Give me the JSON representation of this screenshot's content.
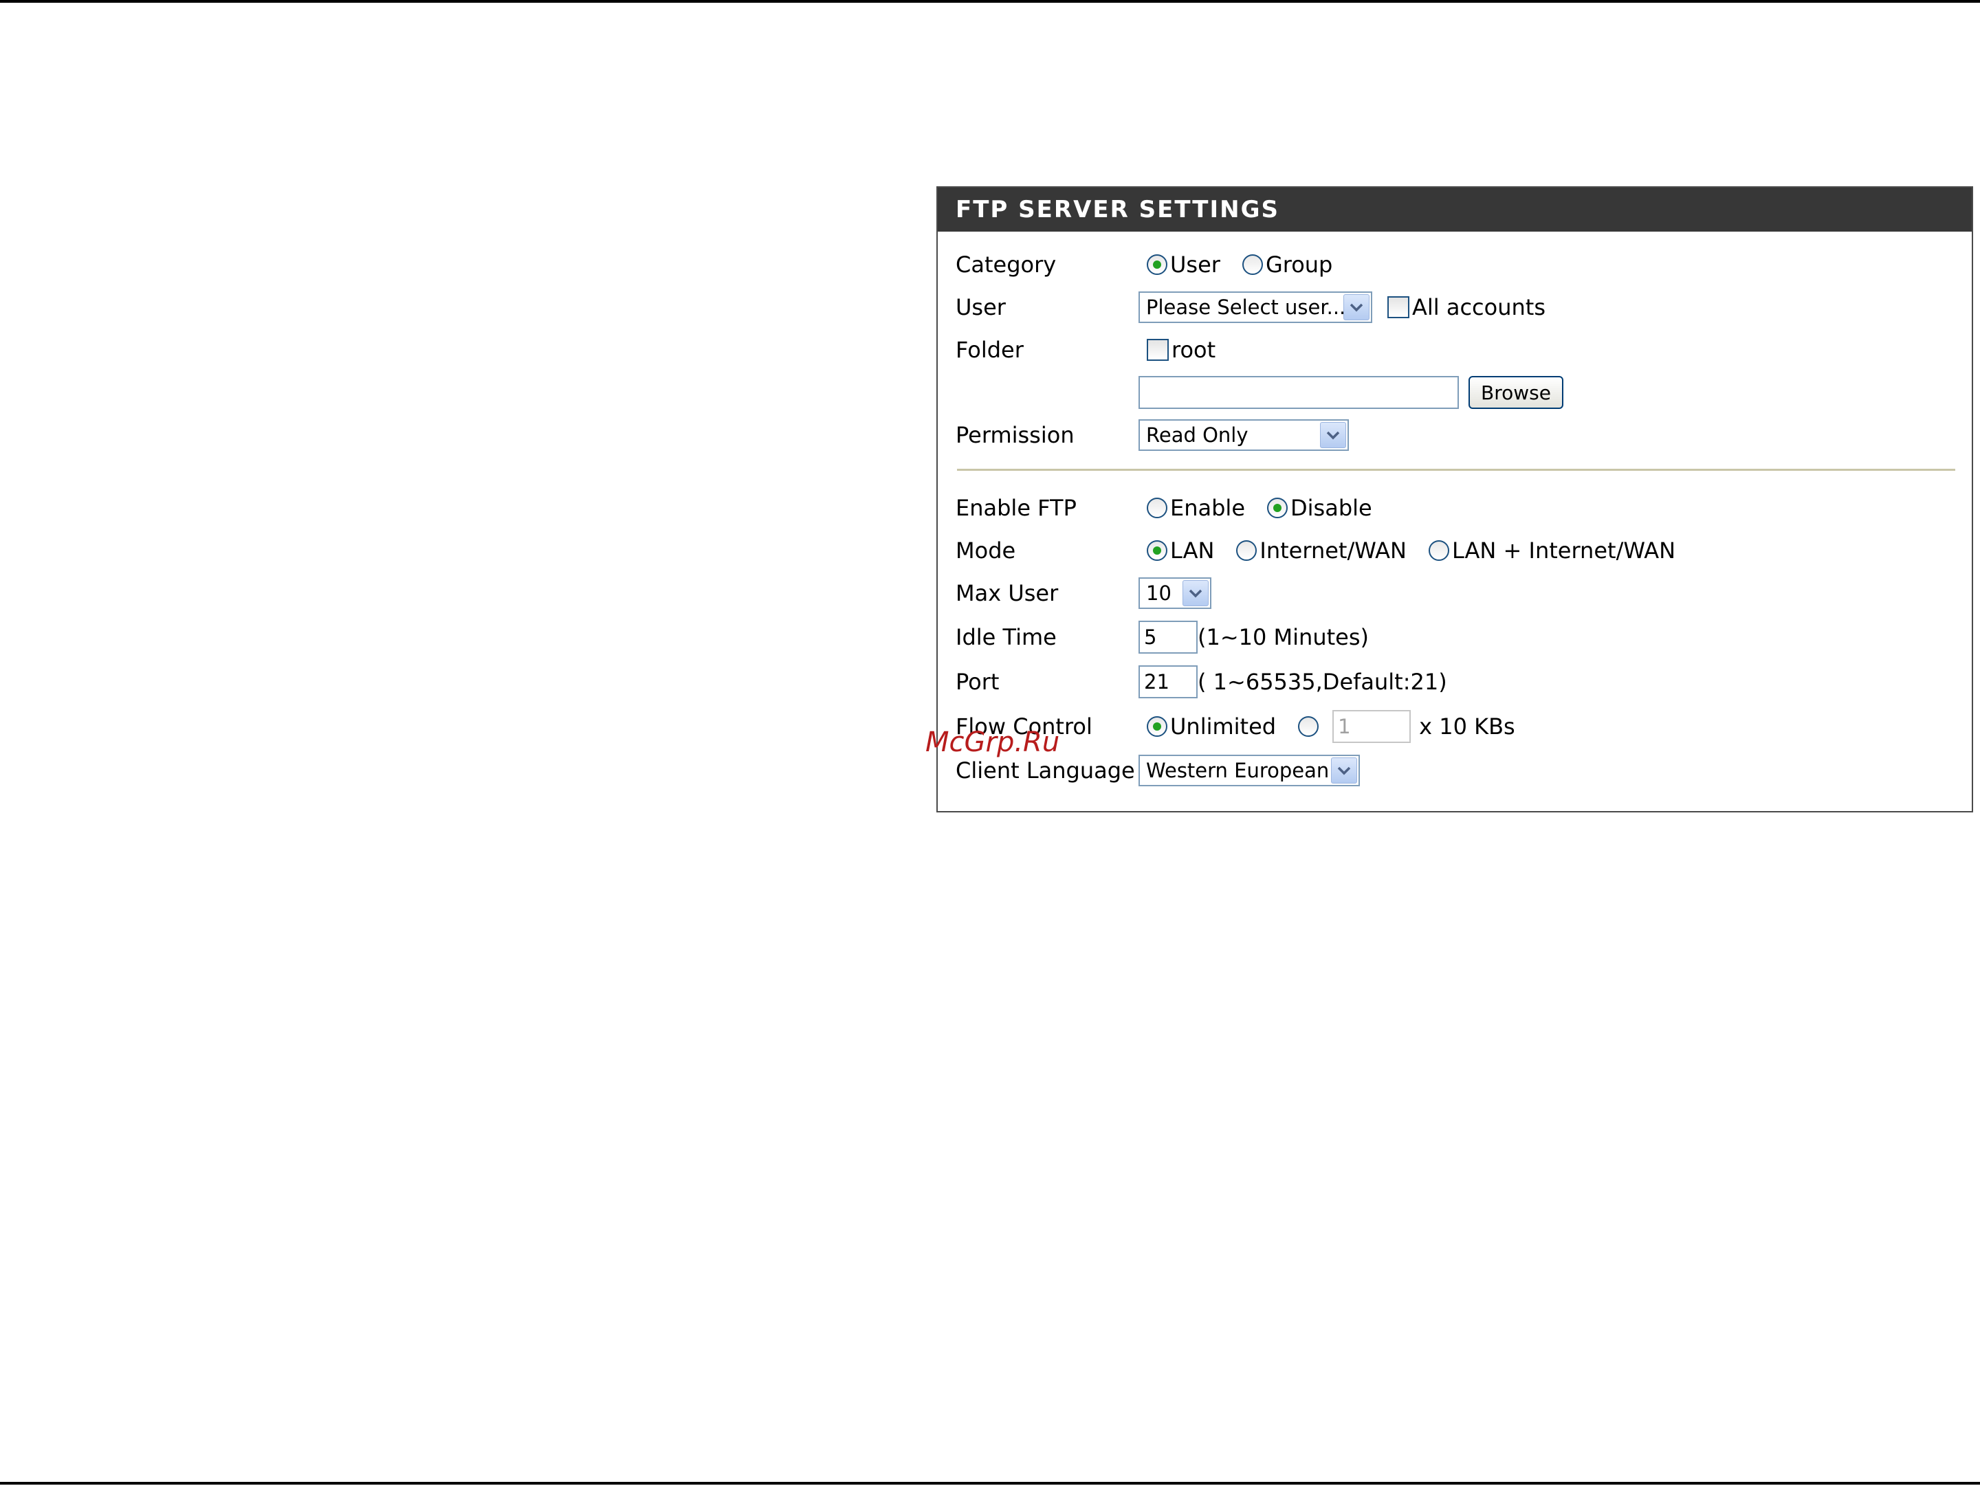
{
  "panel": {
    "title": "FTP SERVER SETTINGS"
  },
  "category": {
    "label": "Category",
    "options": [
      "User",
      "Group"
    ],
    "selected": "User"
  },
  "user": {
    "label": "User",
    "select_value": "Please Select user...",
    "all_accounts_label": "All accounts"
  },
  "folder": {
    "label": "Folder",
    "root_label": "root",
    "path_value": "",
    "browse_label": "Browse"
  },
  "permission": {
    "label": "Permission",
    "select_value": "Read Only"
  },
  "enable_ftp": {
    "label": "Enable FTP",
    "options": [
      "Enable",
      "Disable"
    ],
    "selected": "Disable"
  },
  "mode": {
    "label": "Mode",
    "options": [
      "LAN",
      "Internet/WAN",
      "LAN + Internet/WAN"
    ],
    "selected": "LAN"
  },
  "max_user": {
    "label": "Max User",
    "select_value": "10"
  },
  "idle_time": {
    "label": "Idle Time",
    "value": "5",
    "hint": "(1~10 Minutes)"
  },
  "port": {
    "label": "Port",
    "value": "21",
    "hint": "( 1~65535,Default:21)"
  },
  "flow_control": {
    "label": "Flow Control",
    "unlimited_label": "Unlimited",
    "rate_value": "1",
    "unit_label": "x 10 KBs"
  },
  "client_language": {
    "label": "Client Language",
    "select_value": "Western European"
  },
  "watermark": "McGrp.Ru",
  "colors": {
    "header_bg": "#373737",
    "radio_dot": "#21a121",
    "divider": "#c9c6a8"
  }
}
